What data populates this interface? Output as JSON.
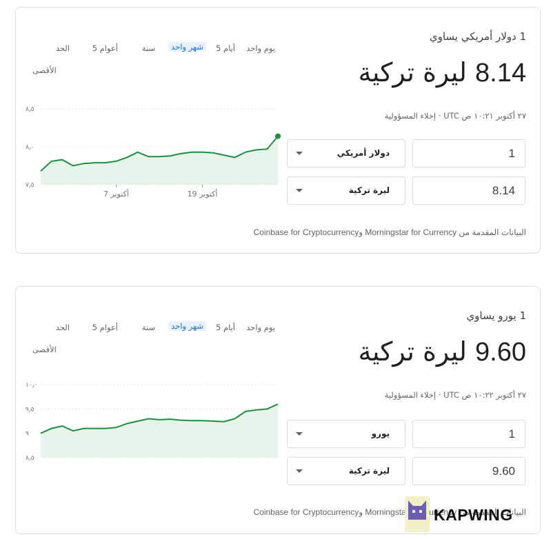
{
  "cards": [
    {
      "equals_text": "1 دولار أمريكي يساوي",
      "result_number": "8.14",
      "result_currency": "ليرة تركية",
      "meta": "٢٧ أكتوبر ١٠:٢١ ص UTC · إخلاء المسؤولية",
      "from_amount": "1",
      "from_currency": "دولار أمريكي",
      "to_amount": "8.14",
      "to_currency": "ليرة تركية",
      "attribution": "البيانات المقدمة من Morningstar for Currency وCoinbase for Cryptocurrency",
      "tabs": [
        "يوم واحد",
        "5 أيام",
        "شهر واحد",
        "سنة",
        "5 أعوام",
        "الحد"
      ],
      "tabs_max_second_line": "الأقصى",
      "active_tab": "شهر واحد"
    },
    {
      "equals_text": "1 يورو يساوي",
      "result_number": "9.60",
      "result_currency": "ليرة تركية",
      "meta": "٢٧ أكتوبر ١٠:٢٢ ص UTC · إخلاء المسؤولية",
      "from_amount": "1",
      "from_currency": "يورو",
      "to_amount": "9.60",
      "to_currency": "ليرة تركية",
      "attribution": "البيانات المقدمة من Morningstar for Currency وCoinbase for Cryptocurrency",
      "tabs": [
        "يوم واحد",
        "5 أيام",
        "شهر واحد",
        "سنة",
        "5 أعوام",
        "الحد"
      ],
      "tabs_max_second_line": "الأقصى",
      "active_tab": "شهر واحد"
    }
  ],
  "chart_data": [
    {
      "type": "area",
      "title": "",
      "y_ticks": [
        "٨٫٥",
        "٨٫٠",
        "٧٫٥"
      ],
      "ylim": [
        7.5,
        8.5
      ],
      "x_ticks": [
        {
          "label": "7 أكتوبر",
          "index": 7
        },
        {
          "label": "19 أكتوبر",
          "index": 15
        }
      ],
      "series": [
        {
          "values": [
            7.68,
            7.81,
            7.83,
            7.75,
            7.78,
            7.79,
            7.79,
            7.81,
            7.86,
            7.93,
            7.87,
            7.87,
            7.88,
            7.91,
            7.93,
            7.93,
            7.92,
            7.89,
            7.86,
            7.93,
            7.96,
            7.97,
            8.14
          ]
        }
      ],
      "line_color": "#1e8e3e",
      "fill_color": "#e6f4ea",
      "grid": true,
      "end_marker": true
    },
    {
      "type": "area",
      "title": "",
      "y_ticks": [
        "١٠٫٠",
        "٩٫٥",
        "٩",
        "٨٫٥"
      ],
      "ylim": [
        8.5,
        10.0
      ],
      "x_ticks": [],
      "series": [
        {
          "values": [
            9.0,
            9.1,
            9.15,
            9.05,
            9.1,
            9.1,
            9.1,
            9.12,
            9.2,
            9.25,
            9.3,
            9.28,
            9.29,
            9.27,
            9.26,
            9.26,
            9.25,
            9.24,
            9.3,
            9.45,
            9.48,
            9.5,
            9.6
          ]
        }
      ],
      "line_color": "#1e8e3e",
      "fill_color": "#e6f4ea",
      "grid": true,
      "end_marker": false
    }
  ],
  "watermark": {
    "text": "KAPWING"
  }
}
